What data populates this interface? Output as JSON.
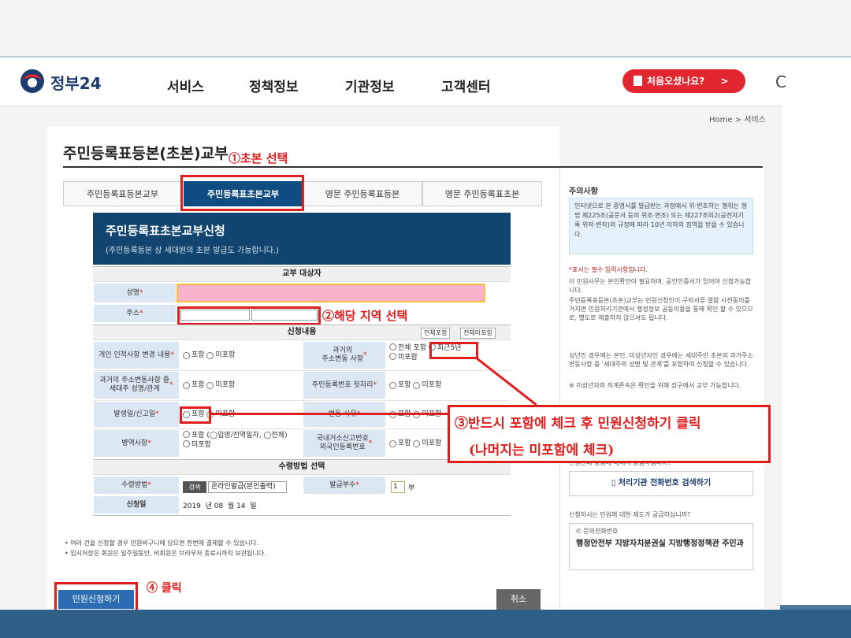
{
  "header": {
    "logo_text": "정부24",
    "nav": [
      "서비스",
      "정책정보",
      "기관정보",
      "고객센터"
    ],
    "cta": "처음오셨나요?",
    "cta_arrow": ">",
    "edge_glyph": "C"
  },
  "breadcrumb": "Home > 서비스",
  "title": "주민등록표등본(초본)교부",
  "tabs": [
    "주민등록표등본교부",
    "주민등록표초본교부",
    "영문 주민등록표등본",
    "영문 주민등록표초본"
  ],
  "form": {
    "heading": "주민등록표초본교부신청",
    "subheading": "(주민등록등본 상 세대원의 초본 발급도 가능합니다.)",
    "section_target": "교부 대상자",
    "name_label": "성명",
    "address_label": "주소",
    "section_content": "신청내용",
    "include_all": "전체포함",
    "exclude_all": "전체미포함",
    "required_mark": "*",
    "opt_include": "포함",
    "opt_exclude": "미포함",
    "rows": {
      "personal_change": "개인 인적사항 변경 내용",
      "past_address": "과거의\n주소변동 사항",
      "past_all": "전체 포함",
      "past_recent": "최근5년",
      "householder_change": "과거의 주소변동사항 중\n세대주 성명/관계",
      "rrn_back": "주민등록번호 뒷자리",
      "issue_date": "발생일/신고일",
      "change_reason": "변동 사유",
      "military": "병역사항",
      "military_detail": "포함 (◯입영/전역일자, ◯전체)",
      "overseas": "국내거소신고번호\n외국인등록번호"
    },
    "section_receive": "수령방법 선택",
    "receive_label": "수령방법",
    "search_btn": "검색",
    "receive_value": "온라인발급(본인출력)",
    "copies_label": "발급부수",
    "copies_value": "1",
    "copies_unit": "부",
    "date_label": "신청일",
    "date_value": "2019  년 08  월 14  일"
  },
  "notes": [
    "• 여러 건을 신청할 경우 민원바구니에 담으면 한번에 결제할 수 있습니다.",
    "• 임시저장은 회원은 일주일동안, 비회원은 브라우저 종료시까지 보관됩니다."
  ],
  "buttons": {
    "submit": "민원신청하기",
    "cancel": "취소"
  },
  "annotations": {
    "a1": "①초본 선택",
    "a2": "②해당 지역 선택",
    "a3_line1": "③반드시 포함에 체크 후 민원신청하기 클릭",
    "a3_line2": "(나머지는 미포함에 체크)",
    "a4": "④ 클릭"
  },
  "side": {
    "title": "주의사항",
    "box": "인터넷으로 본 증명서를 발급받는 과정에서 위·변조하는 행위는 형법 제225조(공문서 등의 위조·변조) 또는 제227조의2(공전자기록 위작·변작)의 규정에 따라 10년 이하의 징역을 받을 수 있습니다.",
    "p1": "*표시는 필수 입력사항입니다.",
    "p2": "이 민원사무는 본인확인이 필요하며, 공인인증서가 있어야 신청가능합니다.",
    "p3": "주민등록표등본(초본)교부는 민원신청인이 구비서류 열람 사전동의를 거치면 민원처리기관에서 행정정보 공동이용을 통해 확인 할 수 있으므로, 별도로 제출하지 않으셔도 됩니다.",
    "p4": "성년인 경우에는 본인, 미성년자인 경우에는 세대주만 초본의 과거주소변동사항 중 '세대주의 성명 및 관계'를 포함하여 신청할 수 있습니다.",
    "p5": "※ 미성년자의 직계존속은 확인을 위해 장구에서 교부 가능합니다.",
    "p6": "민원안내 방법에 대해서 궁금하십니까?",
    "search_btn": "처리기관 전화번호 검색하기",
    "p7": "신청하시는 민원에 대한 제도가 궁금하십니까?",
    "contact_label": "문의전화번호",
    "contact_value": "행정안전부 지방자치분권실 지방행정정책관 주민과"
  },
  "colors": {
    "brand_blue": "#0f4c81",
    "accent_red": "#e1262f",
    "annotation_red": "#e01e1e",
    "name_field_pink": "#f8b3cb"
  }
}
